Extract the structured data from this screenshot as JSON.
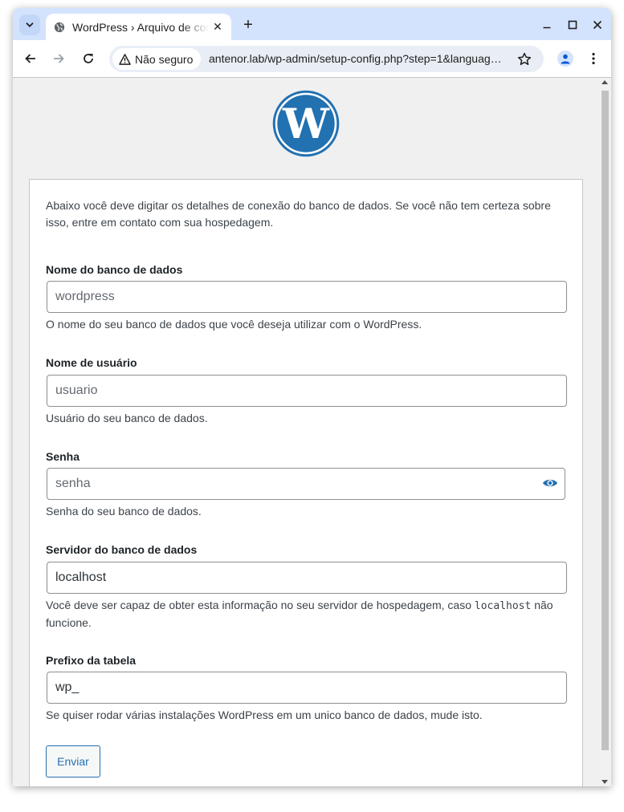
{
  "browser": {
    "tab_title": "WordPress › Arquivo de configuração",
    "security_label": "Não seguro",
    "url": "antenor.lab/wp-admin/setup-config.php?step=1&languag…",
    "new_tab": "+",
    "close_tab": "✕"
  },
  "form": {
    "intro": "Abaixo você deve digitar os detalhes de conexão do banco de dados. Se você não tem certeza sobre isso, entre em contato com sua hospedagem.",
    "dbname": {
      "label": "Nome do banco de dados",
      "placeholder": "wordpress",
      "hint": "O nome do seu banco de dados que você deseja utilizar com o WordPress."
    },
    "uname": {
      "label": "Nome de usuário",
      "placeholder": "usuario",
      "hint": "Usuário do seu banco de dados."
    },
    "pwd": {
      "label": "Senha",
      "placeholder": "senha",
      "hint": "Senha do seu banco de dados."
    },
    "dbhost": {
      "label": "Servidor do banco de dados",
      "value": "localhost",
      "hint_before": "Você deve ser capaz de obter esta informação no seu servidor de hospedagem, caso ",
      "hint_code": "localhost",
      "hint_after": " não funcione."
    },
    "prefix": {
      "label": "Prefixo da tabela",
      "value": "wp_",
      "hint": "Se quiser rodar várias instalações WordPress em um unico banco de dados, mude isto."
    },
    "submit_label": "Enviar"
  },
  "colors": {
    "wp_blue": "#2271b1",
    "tab_strip": "#d3e3fd",
    "page_bg": "#f0f0f1"
  }
}
